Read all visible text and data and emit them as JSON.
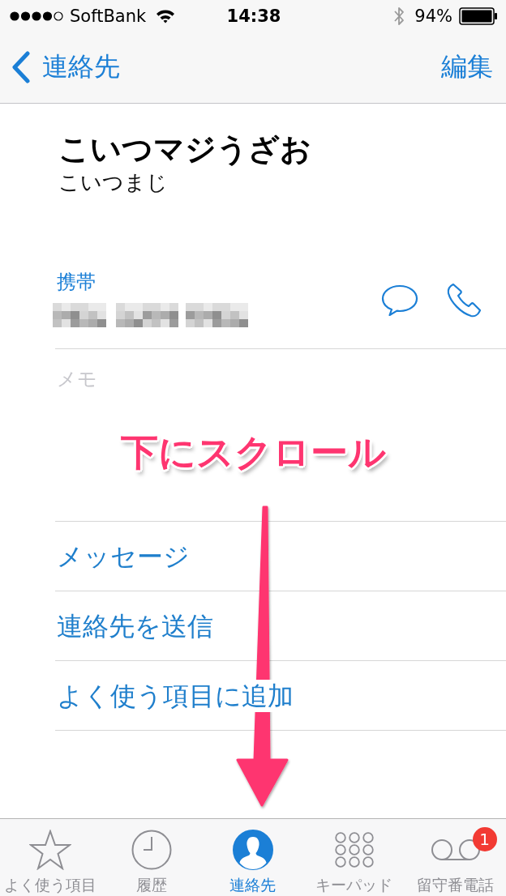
{
  "status_bar": {
    "carrier": "SoftBank",
    "time": "14:38",
    "battery": "94%"
  },
  "nav_bar": {
    "back": "連絡先",
    "action": "編集"
  },
  "contact": {
    "name": "こいつマジうざお",
    "reading": "こいつまじ"
  },
  "phone": {
    "label": "携帯"
  },
  "memo": {
    "placeholder": "メモ"
  },
  "actions": [
    "メッセージ",
    "連絡先を送信",
    "よく使う項目に追加"
  ],
  "annotation": {
    "text": "下にスクロール"
  },
  "tab_bar": [
    {
      "kind": "favorites",
      "label": "よく使う項目",
      "selected": false
    },
    {
      "kind": "recents",
      "label": "履歴",
      "selected": false
    },
    {
      "kind": "contacts",
      "label": "連絡先",
      "selected": true
    },
    {
      "kind": "keypad",
      "label": "キーパッド",
      "selected": false
    },
    {
      "kind": "voicemail",
      "label": "留守番電話",
      "selected": false,
      "badge": "1"
    }
  ]
}
